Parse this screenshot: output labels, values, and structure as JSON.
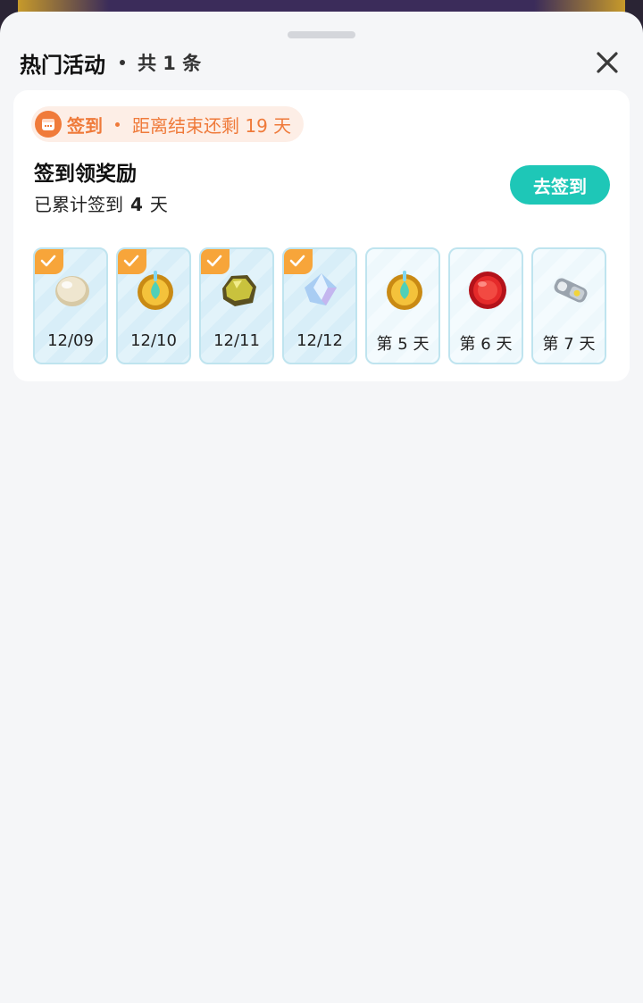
{
  "header": {
    "title": "热门活动",
    "count_text": "共 1 条"
  },
  "activity": {
    "tag_name": "签到",
    "remaining_text": "距离结束还剩 19 天",
    "title": "签到领奖励",
    "progress_prefix": "已累计签到",
    "progress_days": "4",
    "progress_suffix": "天",
    "button_label": "去签到",
    "days": [
      {
        "label": "12/09",
        "checked": true,
        "item": "pearl"
      },
      {
        "label": "12/10",
        "checked": true,
        "item": "gold-coin"
      },
      {
        "label": "12/11",
        "checked": true,
        "item": "gold-nugget"
      },
      {
        "label": "12/12",
        "checked": true,
        "item": "crystal"
      },
      {
        "label": "第 5 天",
        "checked": false,
        "item": "gold-coin"
      },
      {
        "label": "第 6 天",
        "checked": false,
        "item": "bottle-cap"
      },
      {
        "label": "第 7 天",
        "checked": false,
        "item": "pull-tab"
      }
    ]
  },
  "colors": {
    "accent": "#1ec7b7",
    "tag": "#ef7a3a",
    "check": "#f7a53a"
  }
}
